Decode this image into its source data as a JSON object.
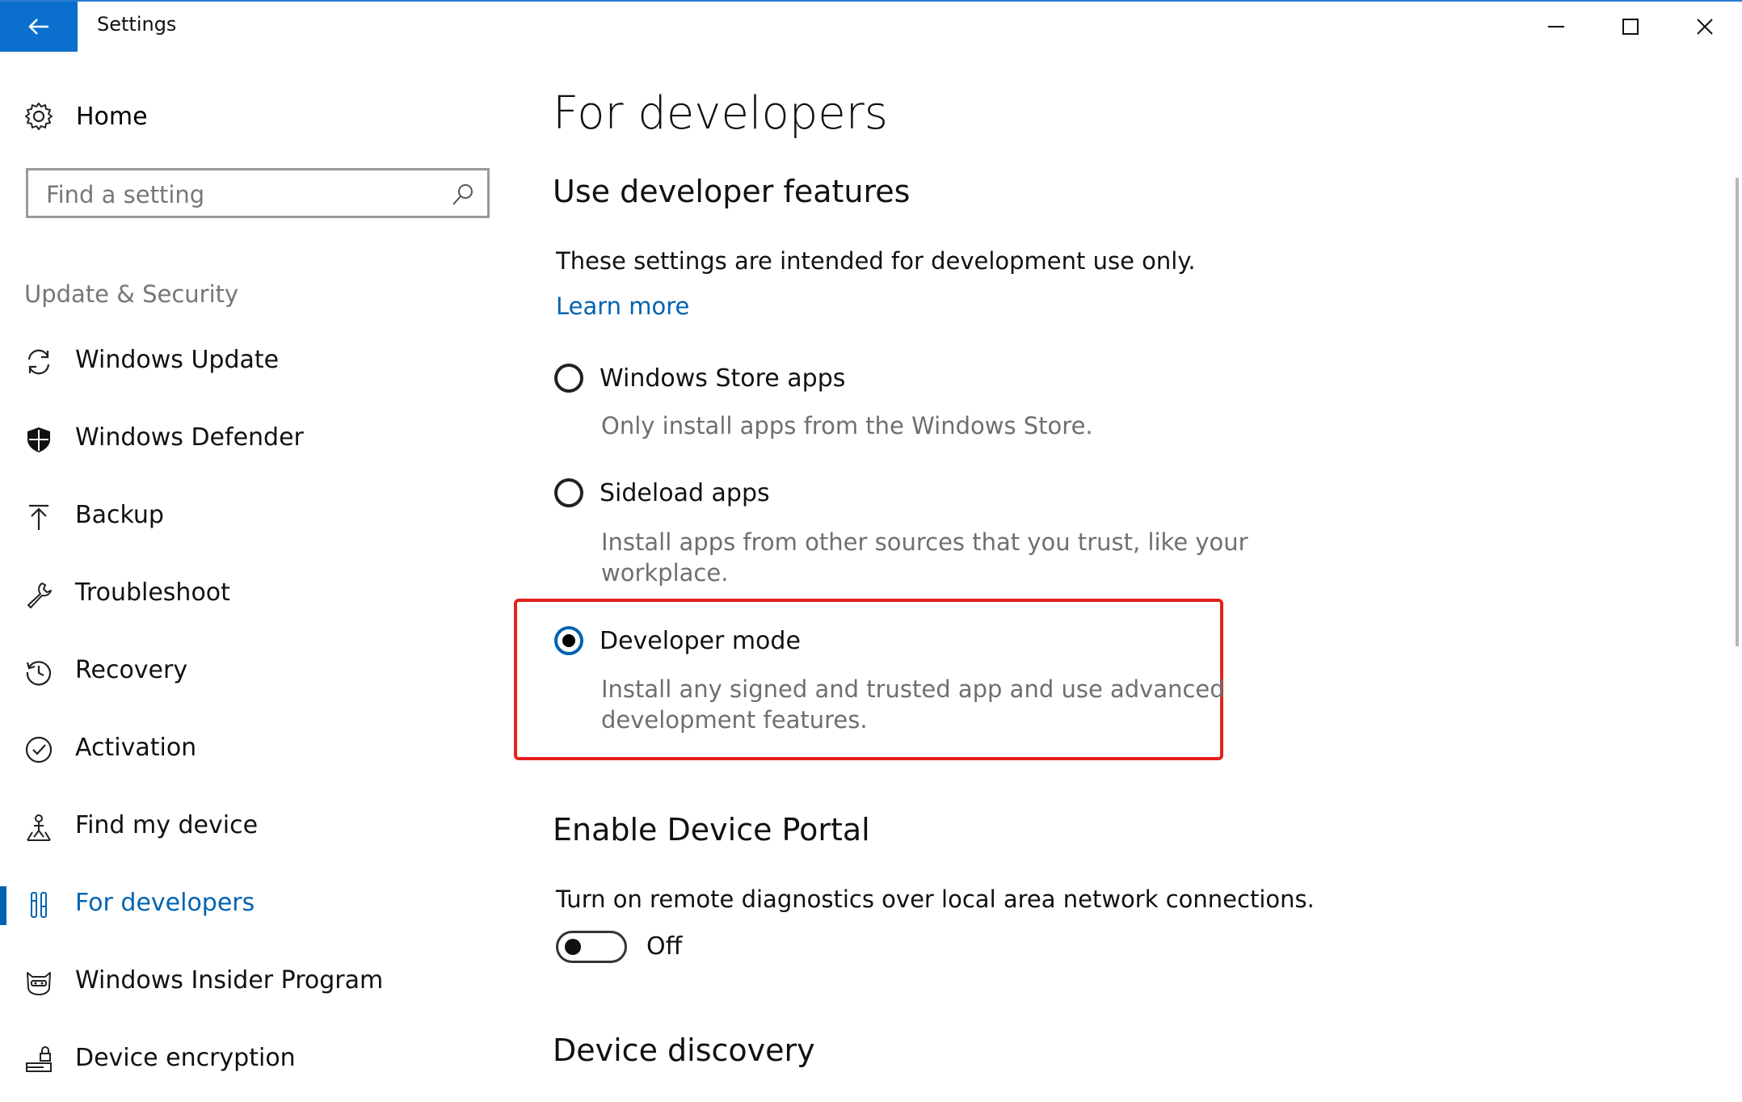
{
  "window": {
    "title": "Settings",
    "accent_color": "#0b6fce",
    "controls": [
      "minimize-icon",
      "maximize-icon",
      "close-icon"
    ]
  },
  "sidebar": {
    "home_label": "Home",
    "search_placeholder": "Find a setting",
    "section_header": "Update & Security",
    "items": [
      {
        "label": "Windows Update",
        "icon": "sync-icon",
        "active": false
      },
      {
        "label": "Windows Defender",
        "icon": "shield-icon",
        "active": false
      },
      {
        "label": "Backup",
        "icon": "upload-arrow-icon",
        "active": false
      },
      {
        "label": "Troubleshoot",
        "icon": "wrench-icon",
        "active": false
      },
      {
        "label": "Recovery",
        "icon": "history-icon",
        "active": false
      },
      {
        "label": "Activation",
        "icon": "check-circle-icon",
        "active": false
      },
      {
        "label": "Find my device",
        "icon": "person-location-icon",
        "active": false
      },
      {
        "label": "For developers",
        "icon": "developer-tools-icon",
        "active": true
      },
      {
        "label": "Windows Insider Program",
        "icon": "ninja-cat-icon",
        "active": false
      },
      {
        "label": "Device encryption",
        "icon": "drive-lock-icon",
        "active": false
      }
    ]
  },
  "main": {
    "title": "For developers",
    "section1": {
      "heading": "Use developer features",
      "intro": "These settings are intended for development use only.",
      "learn_more": "Learn more",
      "options": [
        {
          "label": "Windows Store apps",
          "desc": "Only install apps from the Windows Store.",
          "checked": false
        },
        {
          "label": "Sideload apps",
          "desc": "Install apps from other sources that you trust, like your workplace.",
          "checked": false
        },
        {
          "label": "Developer mode",
          "desc": "Install any signed and trusted app and use advanced development features.",
          "checked": true
        }
      ]
    },
    "section2": {
      "heading": "Enable Device Portal",
      "desc": "Turn on remote diagnostics over local area network connections.",
      "toggle_state": "Off"
    },
    "section3": {
      "heading": "Device discovery"
    }
  }
}
